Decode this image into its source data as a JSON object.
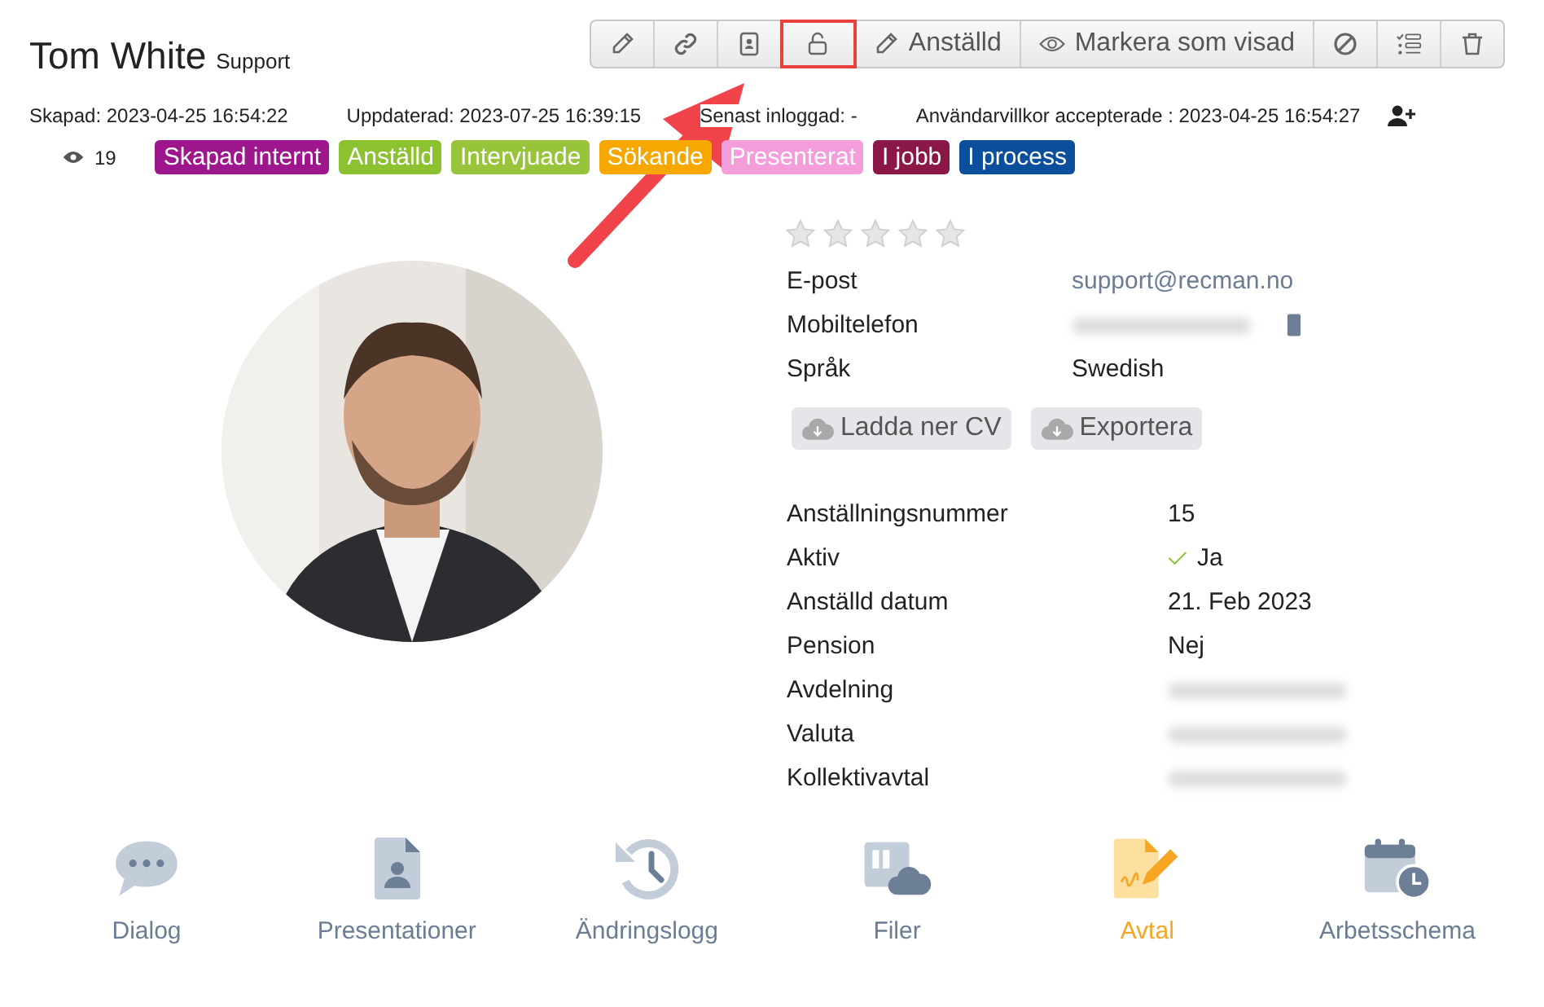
{
  "title": {
    "name": "Tom White",
    "role": "Support"
  },
  "toolbar": [
    {
      "kind": "pencil",
      "highlighted": false
    },
    {
      "kind": "link",
      "highlighted": false
    },
    {
      "kind": "card",
      "highlighted": false
    },
    {
      "kind": "lock",
      "highlighted": true
    },
    {
      "kind": "pencil",
      "label": "Anställd",
      "highlighted": false
    },
    {
      "kind": "eye",
      "label": "Markera som visad",
      "highlighted": false
    },
    {
      "kind": "ban",
      "highlighted": false
    },
    {
      "kind": "list",
      "highlighted": false
    },
    {
      "kind": "trash",
      "highlighted": false
    }
  ],
  "meta": [
    "Skapad: 2023-04-25 16:54:22",
    "Uppdaterad: 2023-07-25 16:39:15",
    "Senast inloggad:  -",
    "Användarvillkor accepterade : 2023-04-25 16:54:27"
  ],
  "views": "19",
  "tags": [
    {
      "label": "Skapad internt",
      "color": "#9e168c"
    },
    {
      "label": "Anställd",
      "color": "#8cc230"
    },
    {
      "label": "Intervjuade",
      "color": "#97c43a"
    },
    {
      "label": "Sökande",
      "color": "#f7a800"
    },
    {
      "label": "Presenterat",
      "color": "#f39ddb"
    },
    {
      "label": "I jobb",
      "color": "#8b1746"
    },
    {
      "label": "I process",
      "color": "#0b4f9c"
    }
  ],
  "stars": 0,
  "contact": [
    {
      "label": "E-post",
      "value": "support@recman.no",
      "kind": "link"
    },
    {
      "label": "Mobiltelefon",
      "kind": "phone",
      "redacted": true
    },
    {
      "label": "Språk",
      "value": "Swedish",
      "kind": "text"
    }
  ],
  "actions": [
    "Ladda ner CV",
    "Exportera"
  ],
  "details": [
    {
      "label": "Anställningsnummer",
      "value": "15"
    },
    {
      "label": "Aktiv",
      "value": "Ja",
      "checked": true
    },
    {
      "label": "Anställd datum",
      "value": "21. Feb 2023"
    },
    {
      "label": "Pension",
      "value": "Nej"
    },
    {
      "label": "Avdelning",
      "redacted": true
    },
    {
      "label": "Valuta",
      "redacted": true
    },
    {
      "label": "Kollektivavtal",
      "redacted": true
    }
  ],
  "bottom_tabs": [
    {
      "label": "Dialog",
      "kind": "chat",
      "selected": false
    },
    {
      "label": "Presentationer",
      "kind": "document",
      "selected": false
    },
    {
      "label": "Ändringslogg",
      "kind": "history",
      "selected": false
    },
    {
      "label": "Filer",
      "kind": "files",
      "selected": false
    },
    {
      "label": "Avtal",
      "kind": "contract",
      "selected": true
    },
    {
      "label": "Arbetsschema",
      "kind": "calendar",
      "selected": false
    }
  ]
}
